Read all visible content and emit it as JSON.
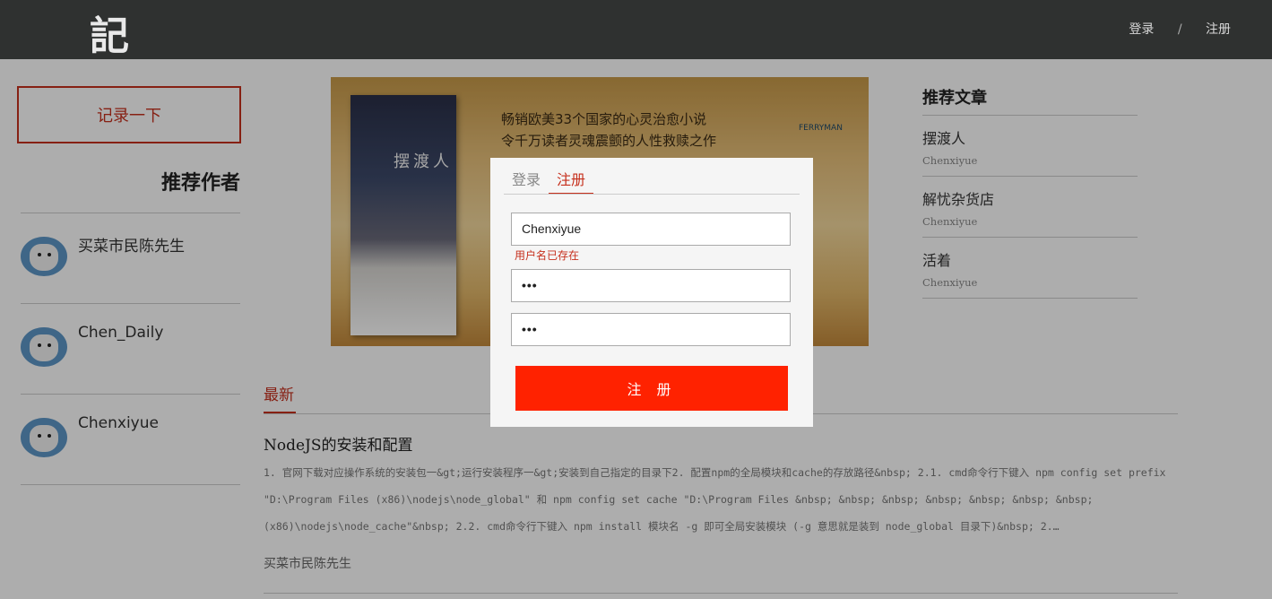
{
  "header": {
    "logo": "記",
    "nav": {
      "login": "登录",
      "separator": "/",
      "register": "注册"
    }
  },
  "left": {
    "record_button": "记录一下",
    "rec_authors_title": "推荐作者",
    "authors": [
      {
        "name": "买菜市民陈先生"
      },
      {
        "name": "Chen_Daily"
      },
      {
        "name": "Chenxiyue"
      }
    ]
  },
  "banner": {
    "book_title": "摆渡人",
    "line1": "畅销欧美33个国家的心灵治愈小说",
    "line2": "令千万读者灵魂震颤的人性救赎之作",
    "brand": "FERRYMAN"
  },
  "main": {
    "latest_tab": "最新",
    "article": {
      "title": "NodeJS的安装和配置",
      "body": "1. 官网下载对应操作系统的安装包一&gt;运行安装程序一&gt;安装到自己指定的目录下2. 配置npm的全局模块和cache的存放路径&nbsp; 2.1. cmd命令行下键入 npm config set prefix \"D:\\Program Files (x86)\\nodejs\\node_global\" 和 npm config set cache \"D:\\Program Files &nbsp; &nbsp; &nbsp; &nbsp; &nbsp; &nbsp; &nbsp; (x86)\\nodejs\\node_cache\"&nbsp; 2.2. cmd命令行下键入 npm install 模块名 -g 即可全局安装模块 (-g 意思就是装到 node_global 目录下)&nbsp; 2.…",
      "author": "买菜市民陈先生"
    }
  },
  "right": {
    "rec_articles_title": "推荐文章",
    "articles": [
      {
        "title": "摆渡人",
        "author": "Chenxiyue"
      },
      {
        "title": "解忧杂货店",
        "author": "Chenxiyue"
      },
      {
        "title": "活着",
        "author": "Chenxiyue"
      }
    ]
  },
  "modal": {
    "tab_login": "登录",
    "tab_register": "注册",
    "username_value": "Chenxiyue",
    "error": "用户名已存在",
    "password_value": "•••",
    "confirm_value": "•••",
    "submit": "注 册"
  },
  "colors": {
    "accent": "#c6301d",
    "submit_bg": "#ff2200",
    "header_bg": "#2f3130"
  }
}
